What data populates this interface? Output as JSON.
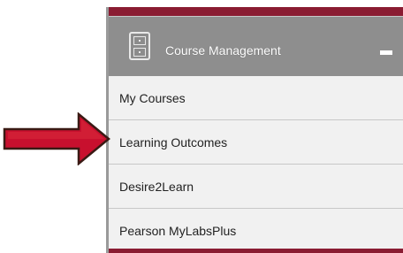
{
  "menu": {
    "title": "Course Management",
    "collapse_icon": "minus-icon",
    "header_icon": "file-cabinet-icon",
    "items": [
      {
        "label": "My Courses"
      },
      {
        "label": "Learning Outcomes"
      },
      {
        "label": "Desire2Learn"
      },
      {
        "label": "Pearson MyLabsPlus"
      }
    ]
  },
  "annotation": {
    "icon": "red-arrow-icon",
    "color": "#c8102e",
    "points_to": "Learning Outcomes"
  },
  "colors": {
    "accent": "#8a1c32",
    "header": "#8e8e8e",
    "item_bg": "#f1f1f1"
  }
}
